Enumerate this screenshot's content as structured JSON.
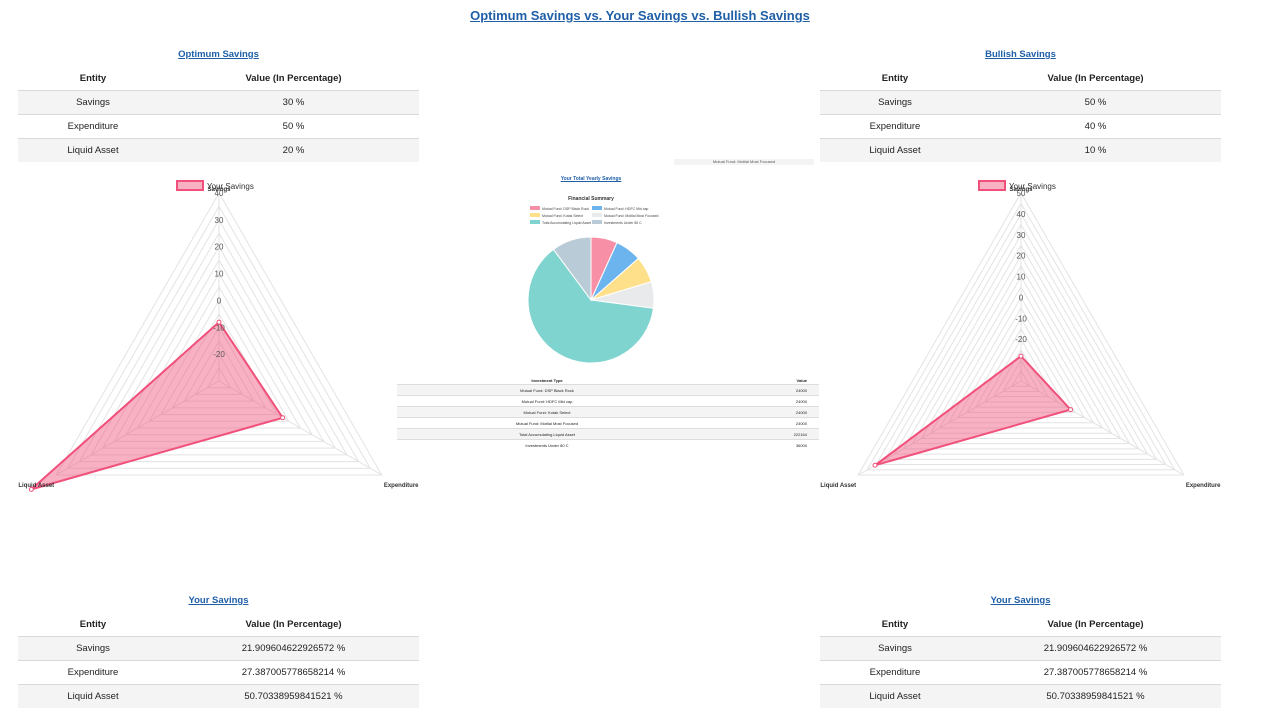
{
  "page_title": "Optimum Savings vs. Your Savings vs. Bullish Savings",
  "optimum": {
    "title": "Optimum Savings",
    "headers": [
      "Entity",
      "Value (In Percentage)"
    ],
    "rows": [
      [
        "Savings",
        "30 %"
      ],
      [
        "Expenditure",
        "50 %"
      ],
      [
        "Liquid Asset",
        "20 %"
      ]
    ]
  },
  "bullish": {
    "title": "Bullish Savings",
    "headers": [
      "Entity",
      "Value (In Percentage)"
    ],
    "rows": [
      [
        "Savings",
        "50 %"
      ],
      [
        "Expenditure",
        "40 %"
      ],
      [
        "Liquid Asset",
        "10 %"
      ]
    ]
  },
  "your_left": {
    "title": "Your Savings",
    "headers": [
      "Entity",
      "Value (In Percentage)"
    ],
    "rows": [
      [
        "Savings",
        "21.909604622926572 %"
      ],
      [
        "Expenditure",
        "27.387005778658214 %"
      ],
      [
        "Liquid Asset",
        "50.70338959841521 %"
      ]
    ]
  },
  "your_right": {
    "title": "Your Savings",
    "headers": [
      "Entity",
      "Value (In Percentage)"
    ],
    "rows": [
      [
        "Savings",
        "21.909604622926572 %"
      ],
      [
        "Expenditure",
        "27.387005778658214 %"
      ],
      [
        "Liquid Asset",
        "50.70338959841521 %"
      ]
    ]
  },
  "center": {
    "title": "Your Total Yearly Savings",
    "hidden_item": "Mutual Fund: Motilal Most Focused",
    "inv_headers": [
      "Investment Type",
      "Value"
    ],
    "inv_rows": [
      [
        "Mutual Fund: DSP Black Rock",
        "24000"
      ],
      [
        "Mutual Fund: HDFC Mid cap",
        "24000"
      ],
      [
        "Mutual Fund: Kotak Select",
        "24000"
      ],
      [
        "Mutual Fund: Motilal Most Focused",
        "24000"
      ],
      [
        "Total Accumulating Liquid Asset",
        "222164"
      ],
      [
        "Investments Under 80 C",
        "36000"
      ]
    ]
  },
  "chart_data": [
    {
      "type": "radar",
      "legend": "Your Savings",
      "labels": [
        "Savings",
        "Expenditure",
        "Liquid Asset"
      ],
      "ticks": [
        40,
        30,
        20,
        10,
        0,
        -10,
        -20
      ],
      "rmin": -30,
      "rmax": 40,
      "values": [
        -8.09,
        -2.61,
        50.7
      ],
      "color": "#f0507a"
    },
    {
      "type": "pie",
      "title": "Financial Summary",
      "labels": [
        "Mutual Fund: DSP Black Rock",
        "Mutual Fund: HDFC Mid cap",
        "Mutual Fund: Kotak Select",
        "Mutual Fund: Motilal Most Focused",
        "Total Accumulating Liquid Asset",
        "Investments Under 80 C"
      ],
      "values": [
        24000,
        24000,
        24000,
        24000,
        222164,
        36000
      ],
      "colors": [
        "#f78fa7",
        "#6cb4ee",
        "#ffe08a",
        "#e8eaeb",
        "#80d4cf",
        "#b9cbd6"
      ]
    },
    {
      "type": "radar",
      "legend": "Your Savings",
      "labels": [
        "Savings",
        "Expenditure",
        "Liquid Asset"
      ],
      "ticks": [
        50,
        40,
        30,
        20,
        10,
        0,
        -10,
        -20
      ],
      "rmin": -40,
      "rmax": 50,
      "values": [
        -28.09,
        -12.61,
        40.7
      ],
      "color": "#f0507a"
    }
  ]
}
